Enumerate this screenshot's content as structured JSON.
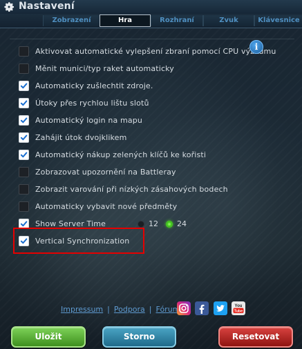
{
  "window": {
    "title": "Nastavení"
  },
  "tabs": [
    {
      "label": "Zobrazení",
      "active": false
    },
    {
      "label": "Hra",
      "active": true
    },
    {
      "label": "Rozhraní",
      "active": false
    },
    {
      "label": "Zvuk",
      "active": false
    },
    {
      "label": "Klávesnice",
      "active": false
    }
  ],
  "options": [
    {
      "label": "Aktivovat automatické vylepšení zbraní pomocí CPU výzkumu",
      "checked": false
    },
    {
      "label": "Měnit munici/typ raket automaticky",
      "checked": false
    },
    {
      "label": "Automaticky zušlechtit zdroje.",
      "checked": true
    },
    {
      "label": "Útoky přes rychlou lištu slotů",
      "checked": true
    },
    {
      "label": "Automatický login na mapu",
      "checked": true
    },
    {
      "label": "Zahájit útok dvojklikem",
      "checked": true
    },
    {
      "label": "Automatický nákup zelených klíčů ke kořisti",
      "checked": true
    },
    {
      "label": "Zobrazovat upozornění na Battleray",
      "checked": false
    },
    {
      "label": "Zobrazit varování při nízkých zásahových bodech",
      "checked": false
    },
    {
      "label": "Automaticky vybavit nové předměty",
      "checked": false
    },
    {
      "label": "Show Server Time",
      "checked": true
    },
    {
      "label": "Vertical Synchronization",
      "checked": true
    }
  ],
  "server_time": {
    "option_12": {
      "label": "12",
      "selected": false
    },
    "option_24": {
      "label": "24",
      "selected": true
    }
  },
  "footer": {
    "links": {
      "impressum": "Impressum",
      "support": "Podpora",
      "forum": "Fórum"
    },
    "separator": "|",
    "social": [
      "instagram-icon",
      "facebook-icon",
      "twitter-icon",
      "youtube-icon"
    ],
    "youtube_text": "You Tube"
  },
  "buttons": {
    "save": "Uložit",
    "cancel": "Storno",
    "reset": "Resetovat"
  },
  "colors": {
    "accent_green": "#4ccf24",
    "tab_text": "#4f8fc0",
    "link": "#5f9bd1",
    "highlight": "#e60000"
  }
}
